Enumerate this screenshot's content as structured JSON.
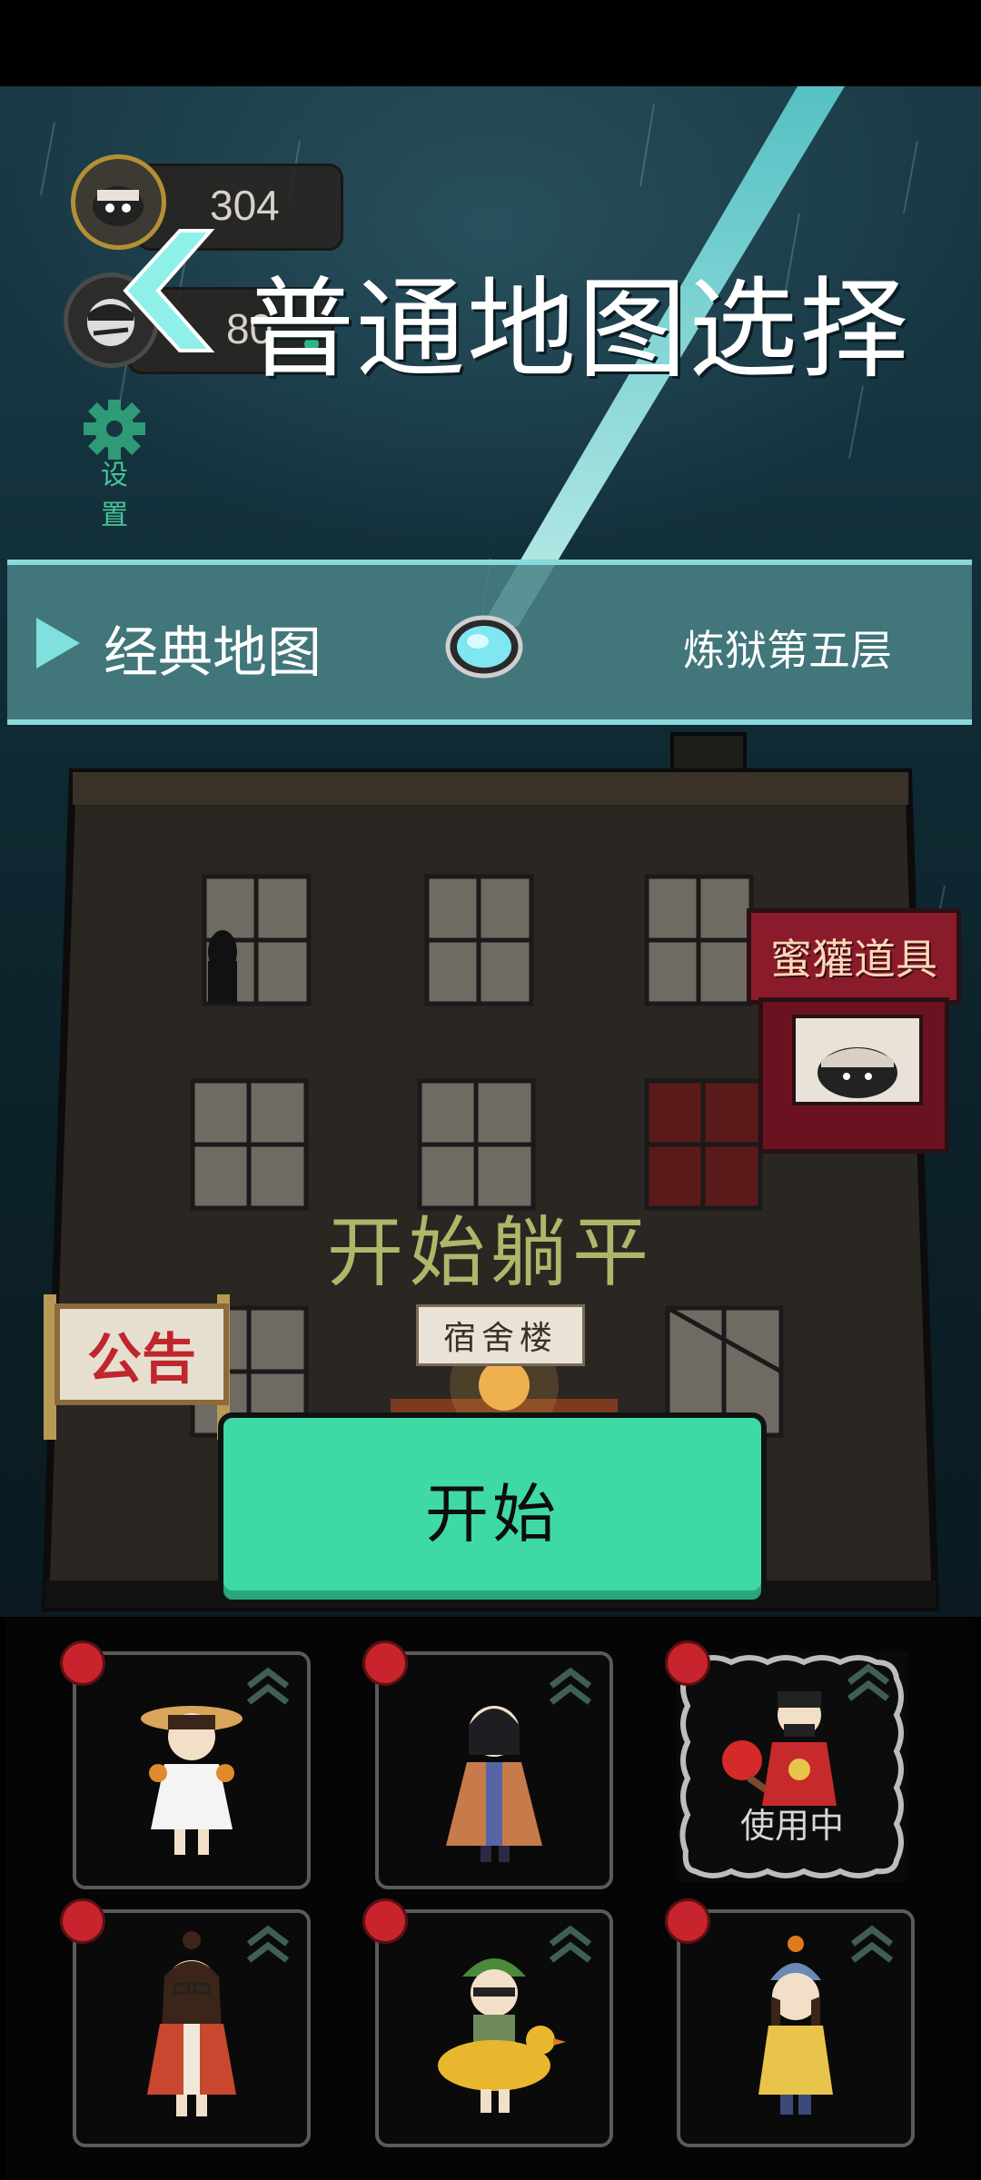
{
  "currency": {
    "coins": "304",
    "secondary": "80"
  },
  "header": {
    "title": "普通地图选择"
  },
  "settings": {
    "label": "设 置"
  },
  "map": {
    "name": "经典地图",
    "floor": "炼狱第五层"
  },
  "scene": {
    "shop_sign": "蜜獾道具",
    "notice": "公告",
    "dorm_label": "宿舍楼",
    "lie_flat": "开始躺平"
  },
  "start_button": {
    "label": "开始"
  },
  "characters": [
    {
      "in_use": ""
    },
    {
      "in_use": ""
    },
    {
      "in_use": "使用中"
    },
    {
      "in_use": ""
    },
    {
      "in_use": ""
    },
    {
      "in_use": ""
    }
  ],
  "colors": {
    "accent_teal": "#3fd9a6",
    "map_bar": "#498287",
    "title_white": "#ffffff",
    "lie_flat_text": "#b1b56a",
    "badge_red": "#c8242d"
  }
}
